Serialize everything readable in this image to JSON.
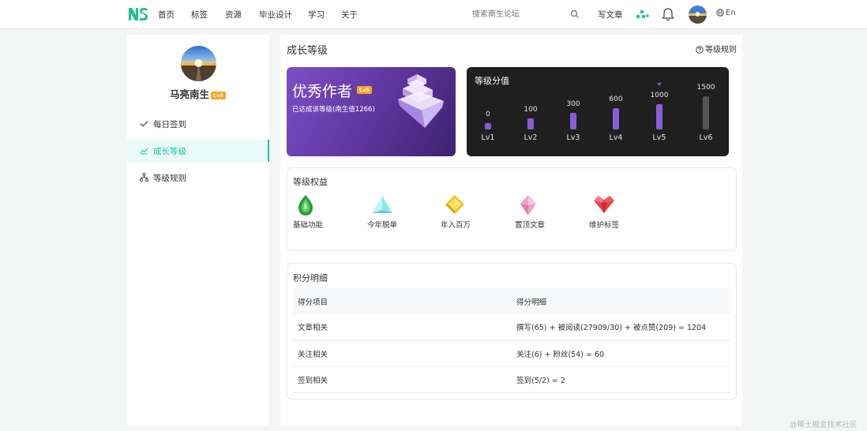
{
  "nav": {
    "logo_text": "NS",
    "links": [
      "首页",
      "标签",
      "资源",
      "毕业设计",
      "学习",
      "关于"
    ],
    "search_placeholder": "搜索南生论坛",
    "write_label": "写文章",
    "lang_label": "En"
  },
  "profile": {
    "name": "马亮南生",
    "level_badge": "Lv5"
  },
  "sidebar": {
    "items": [
      {
        "label": "每日签到",
        "icon": "check-icon"
      },
      {
        "label": "成长等级",
        "icon": "trend-icon",
        "active": true
      },
      {
        "label": "等级规则",
        "icon": "tree-icon"
      }
    ]
  },
  "main": {
    "title": "成长等级",
    "rules_link": "等级规则",
    "hero": {
      "title": "优秀作者",
      "level_badge": "Lv5",
      "subtitle": "已达成该等级(南生值1266)"
    },
    "score": {
      "title": "等级分值",
      "levels": [
        {
          "label": "Lv1",
          "value": "0",
          "reached": true
        },
        {
          "label": "Lv2",
          "value": "100",
          "reached": true
        },
        {
          "label": "Lv3",
          "value": "300",
          "reached": true
        },
        {
          "label": "Lv4",
          "value": "600",
          "reached": true
        },
        {
          "label": "Lv5",
          "value": "1000",
          "reached": true,
          "current": true
        },
        {
          "label": "Lv6",
          "value": "1500",
          "reached": false
        }
      ]
    },
    "rights": {
      "title": "等级权益",
      "items": [
        {
          "label": "基础功能",
          "icon": "green-gem-icon",
          "color": "#2e9e3a"
        },
        {
          "label": "今年脱单",
          "icon": "cyan-pyramid-icon",
          "color": "#6fd6e4"
        },
        {
          "label": "年入百万",
          "icon": "yellow-gem-icon",
          "color": "#f5c518"
        },
        {
          "label": "置顶文章",
          "icon": "pink-crystal-icon",
          "color": "#f2a0c8"
        },
        {
          "label": "维护标签",
          "icon": "red-heart-gem-icon",
          "color": "#e8414b"
        }
      ]
    },
    "points": {
      "title": "积分明细",
      "headers": [
        "得分项目",
        "得分明细"
      ],
      "rows": [
        [
          "文章相关",
          "撰写(65) + 被阅读(27909/30) + 被点赞(209) = 1204"
        ],
        [
          "关注相关",
          "关注(6) + 粉丝(54) = 60"
        ],
        [
          "签到相关",
          "签到(5/2) = 2"
        ]
      ]
    }
  },
  "watermark": "@稀土掘金技术社区",
  "colors": {
    "accent": "#1cc2a6",
    "purple": "#8b5cd6",
    "badge": "#f5a623"
  }
}
